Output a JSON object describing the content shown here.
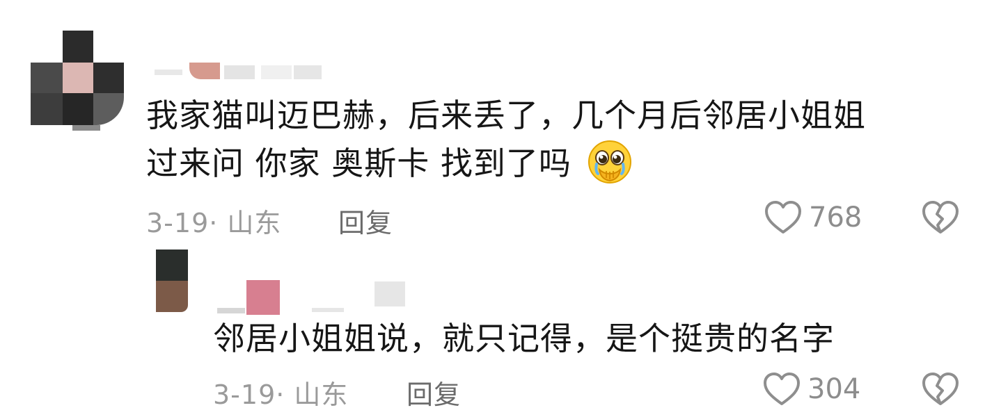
{
  "comments": [
    {
      "text_line1": "我家猫叫迈巴赫，后来丢了，几个月后邻居小姐姐",
      "text_line2": "过来问 你家 奥斯卡 找到了吗",
      "emoji": "pleading-face-emoji",
      "date": "3-19",
      "location": "· 山东",
      "reply_label": "回复",
      "likes": "768",
      "colors": {
        "avatar": [
          "#1f1f1f",
          "#3a3a3a",
          "#d9b8b4",
          "#6a6a6a"
        ],
        "name_accent": "#c98f85"
      },
      "replies": [
        {
          "text": "邻居小姐姐说，就只记得，是个挺贵的名字",
          "date": "3-19",
          "location": "· 山东",
          "reply_label": "回复",
          "likes": "304",
          "colors": {
            "avatar": [
              "#2a2a2a",
              "#7a5a4a"
            ],
            "name_accent": "#d9788e"
          }
        }
      ]
    }
  ],
  "icons": {
    "like": "heart-outline-icon",
    "dislike": "broken-heart-icon"
  }
}
